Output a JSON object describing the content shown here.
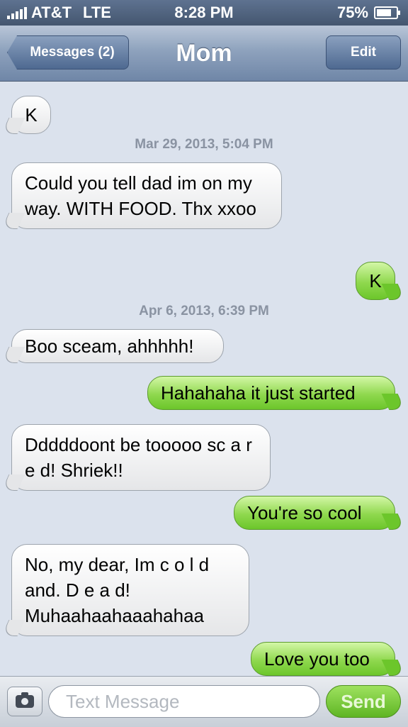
{
  "status_bar": {
    "carrier": "AT&T",
    "network": "LTE",
    "time": "8:28 PM",
    "battery_text": "75%",
    "battery_level": 0.75
  },
  "nav": {
    "back_label": "Messages (2)",
    "title": "Mom",
    "edit_label": "Edit"
  },
  "conversation": {
    "timestamps": [
      "Mar 29, 2013, 5:04 PM",
      "Apr 6, 2013, 6:39 PM"
    ],
    "messages": [
      {
        "from": "them",
        "text": "K"
      },
      {
        "from": "them",
        "text": "Could you tell dad im on my way. WITH FOOD.  Thx xxoo"
      },
      {
        "from": "me",
        "text": "K"
      },
      {
        "from": "them",
        "text": "Boo sceam, ahhhhh!"
      },
      {
        "from": "me",
        "text": "Hahahaha it just started"
      },
      {
        "from": "them",
        "text": "Dddddoont be tooooo sc a r e d!    Shriek!!"
      },
      {
        "from": "me",
        "text": "You're so cool"
      },
      {
        "from": "them",
        "text": "No, my dear, Im c o l d and. D e a d! Muhaahaahaaahahaa"
      },
      {
        "from": "me",
        "text": "Love you too"
      }
    ]
  },
  "compose": {
    "placeholder": "Text Message",
    "send_label": "Send"
  },
  "icons": {
    "camera": "camera-icon",
    "signal": "signal-bars-icon",
    "battery": "battery-icon"
  }
}
